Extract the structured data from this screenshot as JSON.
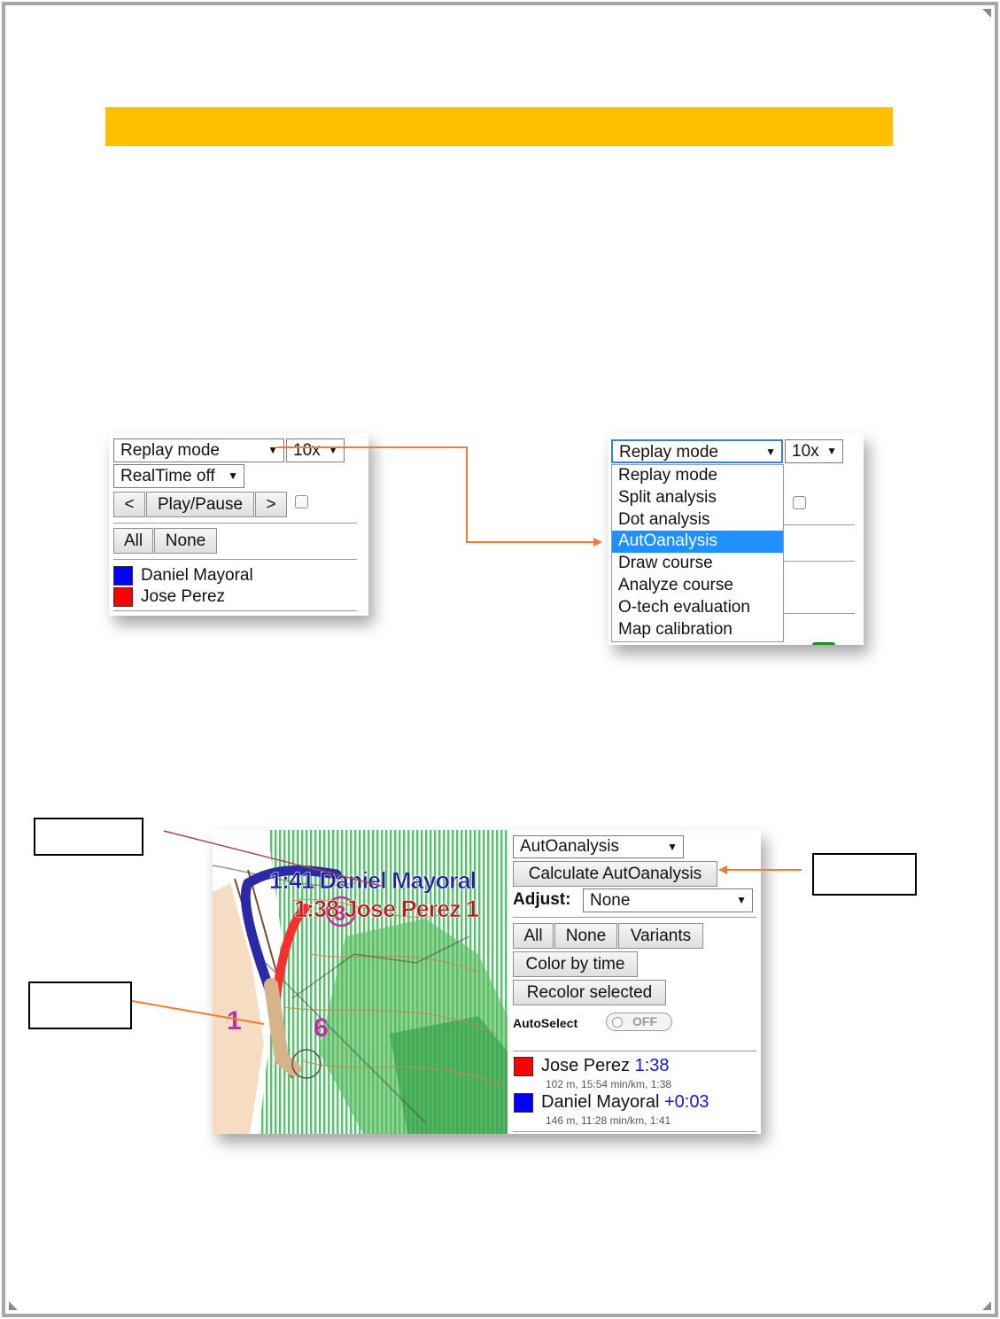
{
  "colors": {
    "title_bar": "#ffc000",
    "arrow": "#ed7d31",
    "highlight": "#1e90ff",
    "runner_blue": "#0000ff",
    "runner_red": "#ff0000"
  },
  "panel_left": {
    "mode_select": "Replay mode",
    "speed_select": "10x",
    "realtime_select": "RealTime off",
    "prev_button": "<",
    "play_pause_button": "Play/Pause",
    "next_button": ">",
    "all_button": "All",
    "none_button": "None",
    "runners": [
      {
        "name": "Daniel Mayoral",
        "color": "#0000ff"
      },
      {
        "name": "Jose Perez",
        "color": "#ff0000"
      }
    ]
  },
  "panel_right": {
    "mode_select": "Replay mode",
    "speed_select": "10x",
    "menu_items": [
      "Replay mode",
      "Split analysis",
      "Dot analysis",
      "AutOanalysis",
      "Draw course",
      "Analyze course",
      "O-tech evaluation",
      "Map calibration"
    ],
    "highlighted_item": "AutOanalysis"
  },
  "panel_bottom": {
    "map": {
      "label_blue": "1:41 Daniel Mayoral",
      "label_red": "1:38 Jose Perez 1",
      "control_3": "3",
      "control_1": "1",
      "control_6": "6"
    },
    "mode_select": "AutOanalysis",
    "calculate_button": "Calculate AutOanalysis",
    "adjust_label": "Adjust:",
    "adjust_select": "None",
    "all_button": "All",
    "none_button": "None",
    "variants_button": "Variants",
    "color_by_time_button": "Color by time",
    "recolor_button": "Recolor selected",
    "autoselect_label": "AutoSelect",
    "toggle_state": "OFF",
    "results": [
      {
        "name": "Jose Perez",
        "time": "1:38",
        "detail": "102 m, 15:54 min/km, 1:38",
        "color": "#ff0000"
      },
      {
        "name": "Daniel Mayoral",
        "time": "+0:03",
        "detail": "146 m, 11:28 min/km, 1:41",
        "color": "#0000ff"
      }
    ]
  }
}
